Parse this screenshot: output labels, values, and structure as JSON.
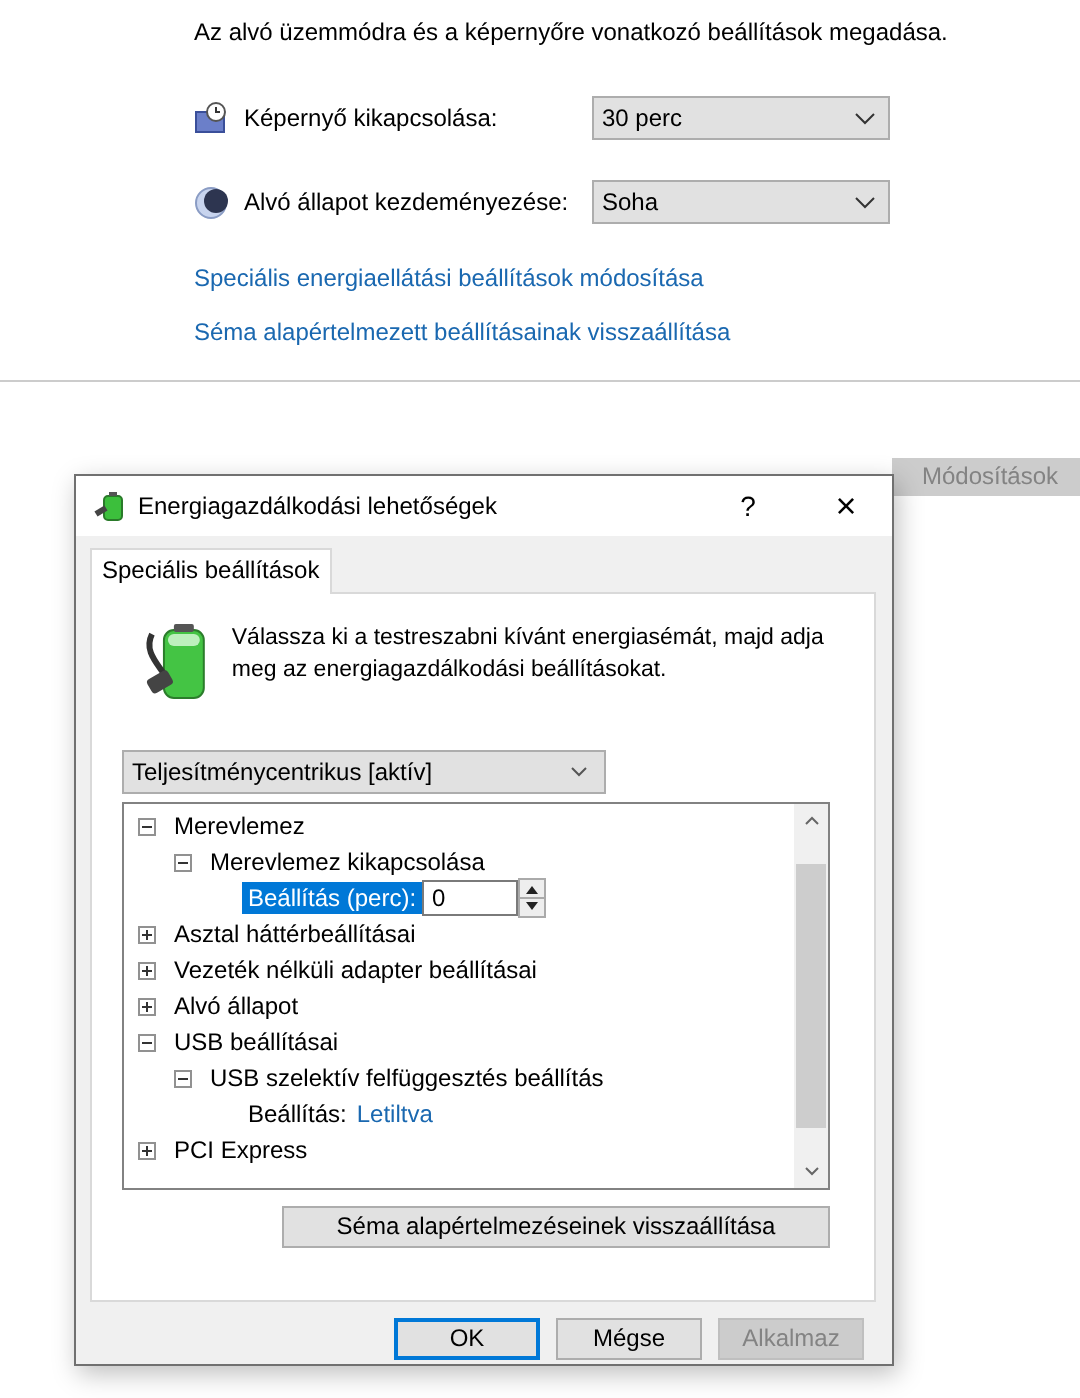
{
  "page": {
    "description": "Az alvó üzemmódra és a képernyőre vonatkozó beállítások megadása.",
    "settings": [
      {
        "kind": "display",
        "label": "Képernyő kikapcsolása:",
        "value": "30 perc"
      },
      {
        "kind": "sleep",
        "label": "Alvó állapot kezdeményezése:",
        "value": "Soha"
      }
    ],
    "links": [
      "Speciális energiaellátási beállítások módosítása",
      "Séma alapértelmezett beállításainak visszaállítása"
    ],
    "save_button": {
      "label": "Módosítások",
      "disabled": true
    }
  },
  "dialog": {
    "title": "Energiagazdálkodási lehetőségek",
    "help": "?",
    "close": "×",
    "tabs": [
      {
        "label": "Speciális beállítások",
        "selected": true
      }
    ],
    "intro": "Válassza ki a testreszabni kívánt energiasémát, majd adja meg az energiagazdálkodási beállításokat.",
    "plan": "Teljesítménycentrikus [aktív]",
    "tree": [
      {
        "kind": "group",
        "label": "Merevlemez",
        "expanded": true,
        "children": [
          {
            "kind": "group",
            "label": "Merevlemez kikapcsolása",
            "expanded": true,
            "children": [
              {
                "kind": "spin",
                "label": "Beállítás (perc):",
                "value": "0",
                "selected": true
              }
            ]
          }
        ]
      },
      {
        "kind": "group",
        "label": "Asztal háttérbeállításai",
        "expanded": false
      },
      {
        "kind": "group",
        "label": "Vezeték nélküli adapter beállításai",
        "expanded": false
      },
      {
        "kind": "group",
        "label": "Alvó állapot",
        "expanded": false
      },
      {
        "kind": "group",
        "label": "USB beállításai",
        "expanded": true,
        "children": [
          {
            "kind": "group",
            "label": "USB szelektív felfüggesztés beállítás",
            "expanded": true,
            "children": [
              {
                "kind": "value",
                "label": "Beállítás:",
                "value": "Letiltva",
                "selected": false
              }
            ]
          }
        ]
      },
      {
        "kind": "group",
        "label": "PCI Express",
        "expanded": false
      }
    ],
    "restore_button": "Séma alapértelmezéseinek visszaállítása",
    "buttons": [
      {
        "label": "OK",
        "default": true,
        "disabled": false
      },
      {
        "label": "Mégse",
        "default": false,
        "disabled": false
      },
      {
        "label": "Alkalmaz",
        "default": false,
        "disabled": true
      }
    ]
  }
}
